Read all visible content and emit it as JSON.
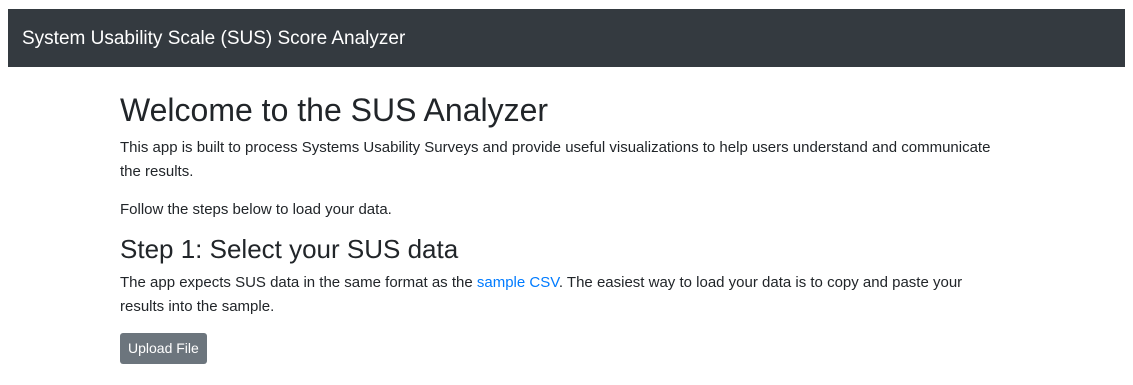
{
  "header": {
    "title": "System Usability Scale (SUS) Score Analyzer"
  },
  "main": {
    "heading": "Welcome to the SUS Analyzer",
    "intro": "This app is built to process Systems Usability Surveys and provide useful visualizations to help users understand and communicate the results.",
    "follow": "Follow the steps below to load your data.",
    "step1": {
      "heading": "Step 1: Select your SUS data",
      "text_before_link": "The app expects SUS data in the same format as the ",
      "link_text": "sample CSV",
      "text_after_link": ". The easiest way to load your data is to copy and paste your results into the sample.",
      "upload_label": "Upload File"
    }
  },
  "colors": {
    "header_bg": "#343a40",
    "link": "#007bff",
    "button_bg": "#6c757d"
  }
}
